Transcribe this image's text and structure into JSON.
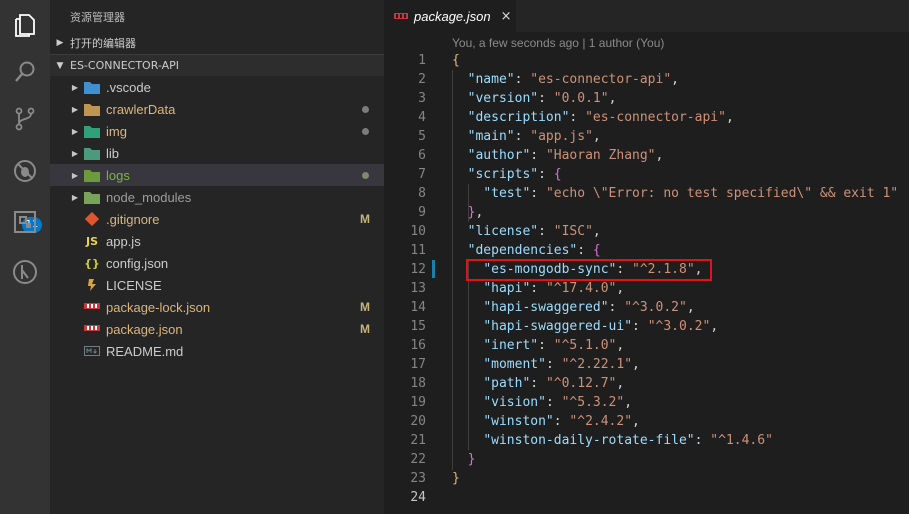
{
  "activity_bar": {
    "items": [
      "files-icon",
      "search-icon",
      "source-control-icon",
      "debug-icon",
      "extensions-icon",
      "remote-icon"
    ],
    "scm_badge": "11"
  },
  "sidebar": {
    "title": "资源管理器",
    "open_editors_label": "打开的编辑器",
    "project_label": "ES-CONNECTOR-API",
    "items": [
      {
        "name": ".vscode",
        "type": "folder",
        "icon": "vscode-folder-icon"
      },
      {
        "name": "crawlerData",
        "type": "folder",
        "icon": "folder-icon",
        "status": "dot"
      },
      {
        "name": "img",
        "type": "folder",
        "icon": "image-folder-icon",
        "status": "dot"
      },
      {
        "name": "lib",
        "type": "folder",
        "icon": "lib-folder-icon"
      },
      {
        "name": "logs",
        "type": "folder",
        "icon": "logs-folder-icon",
        "status": "dot"
      },
      {
        "name": "node_modules",
        "type": "folder",
        "icon": "node-folder-icon"
      },
      {
        "name": ".gitignore",
        "type": "file",
        "icon": "git-icon",
        "status": "M"
      },
      {
        "name": "app.js",
        "type": "file",
        "icon": "js-icon",
        "icon_text": "JS"
      },
      {
        "name": "config.json",
        "type": "file",
        "icon": "json-icon",
        "icon_text": "{}"
      },
      {
        "name": "LICENSE",
        "type": "file",
        "icon": "license-icon"
      },
      {
        "name": "package-lock.json",
        "type": "file",
        "icon": "npm-icon",
        "status": "M"
      },
      {
        "name": "package.json",
        "type": "file",
        "icon": "npm-icon",
        "status": "M"
      },
      {
        "name": "README.md",
        "type": "file",
        "icon": "markdown-icon"
      }
    ]
  },
  "editor": {
    "tab_label": "package.json",
    "tab_close": "×",
    "blame": "You, a few seconds ago | 1 author (You)",
    "active_line": "24",
    "lines": [
      {
        "n": "1",
        "text": "{"
      },
      {
        "n": "2",
        "text": "  \"name\": \"es-connector-api\","
      },
      {
        "n": "3",
        "text": "  \"version\": \"0.0.1\","
      },
      {
        "n": "4",
        "text": "  \"description\": \"es-connector-api\","
      },
      {
        "n": "5",
        "text": "  \"main\": \"app.js\","
      },
      {
        "n": "6",
        "text": "  \"author\": \"Haoran Zhang\","
      },
      {
        "n": "7",
        "text": "  \"scripts\": {"
      },
      {
        "n": "8",
        "text": "    \"test\": \"echo \\\"Error: no test specified\\\" && exit 1\""
      },
      {
        "n": "9",
        "text": "  },"
      },
      {
        "n": "10",
        "text": "  \"license\": \"ISC\","
      },
      {
        "n": "11",
        "text": "  \"dependencies\": {"
      },
      {
        "n": "12",
        "text": "    \"es-mongodb-sync\": \"^2.1.8\","
      },
      {
        "n": "13",
        "text": "    \"hapi\": \"^17.4.0\","
      },
      {
        "n": "14",
        "text": "    \"hapi-swaggered\": \"^3.0.2\","
      },
      {
        "n": "15",
        "text": "    \"hapi-swaggered-ui\": \"^3.0.2\","
      },
      {
        "n": "16",
        "text": "    \"inert\": \"^5.1.0\","
      },
      {
        "n": "17",
        "text": "    \"moment\": \"^2.22.1\","
      },
      {
        "n": "18",
        "text": "    \"path\": \"^0.12.7\","
      },
      {
        "n": "19",
        "text": "    \"vision\": \"^5.3.2\","
      },
      {
        "n": "20",
        "text": "    \"winston\": \"^2.4.2\","
      },
      {
        "n": "21",
        "text": "    \"winston-daily-rotate-file\": \"^1.4.6\""
      },
      {
        "n": "22",
        "text": "  }"
      },
      {
        "n": "23",
        "text": "}"
      },
      {
        "n": "24",
        "text": ""
      }
    ]
  },
  "colors": {
    "accent": "#007acc",
    "highlight_box": "#e0131b",
    "modified": "#c5b37e"
  }
}
